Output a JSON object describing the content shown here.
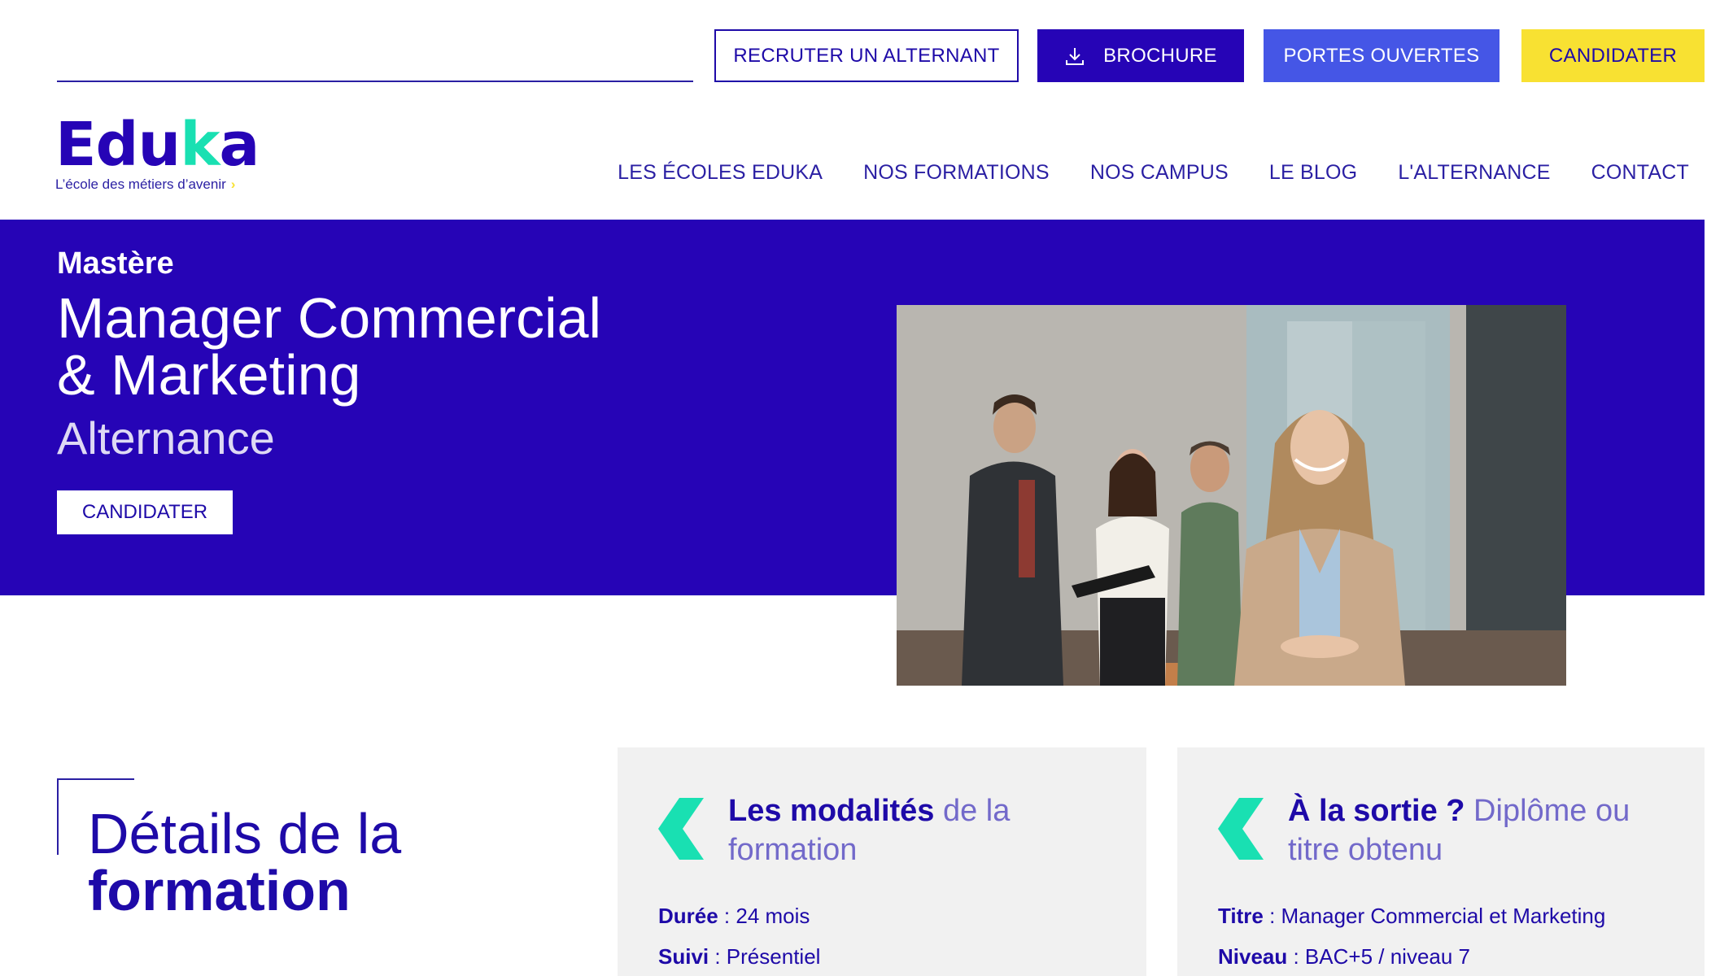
{
  "top_buttons": {
    "recruter": "RECRUTER UN ALTERNANT",
    "brochure": "BROCHURE",
    "portes_ouvertes": "PORTES OUVERTES",
    "candidater": "CANDIDATER"
  },
  "logo": {
    "word_start": "Edu",
    "word_k": "k",
    "word_end": "a",
    "tagline": "L’école des métiers d’avenir",
    "tagline_chevron": "›"
  },
  "nav": [
    "LES ÉCOLES EDUKA",
    "NOS FORMATIONS",
    "NOS CAMPUS",
    "LE BLOG",
    "L'ALTERNANCE",
    "CONTACT"
  ],
  "hero": {
    "kicker": "Mastère",
    "title_line1": "Manager Commercial",
    "title_line2": "& Marketing",
    "subtitle": "Alternance",
    "cta": "CANDIDATER"
  },
  "details": {
    "title_light": "Détails de la",
    "title_bold": "formation"
  },
  "cards": [
    {
      "heading_strong": "Les modalités",
      "heading_soft": " de la formation",
      "lines": [
        {
          "label": "Durée",
          "value": " : 24 mois"
        },
        {
          "label": "Suivi",
          "value": " : Présentiel"
        }
      ]
    },
    {
      "heading_strong": "À la sortie ?",
      "heading_soft": " Diplôme ou titre obtenu",
      "lines": [
        {
          "label": "Titre",
          "value": " : Manager Commercial et Marketing"
        },
        {
          "label": "Niveau",
          "value": " : BAC+5 / niveau 7"
        }
      ]
    }
  ],
  "colors": {
    "primary": "#2604b6",
    "accent_blue": "#4556e6",
    "accent_yellow": "#f8e132",
    "accent_teal": "#19e0b2",
    "card_bg": "#f1f1f1"
  },
  "icons": {
    "brochure": "download-icon",
    "card": "chevron-left-icon"
  }
}
